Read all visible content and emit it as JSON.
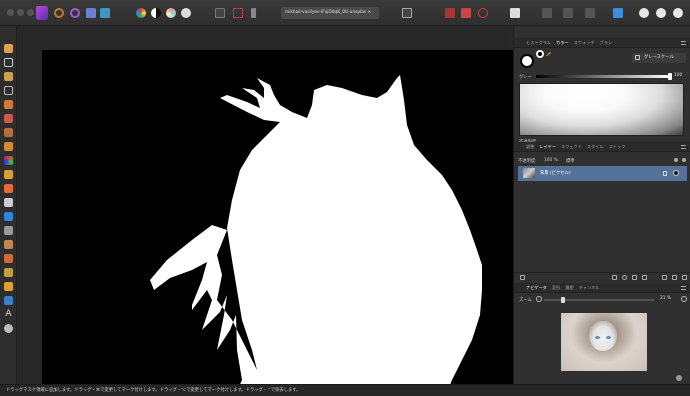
{
  "toolbar": {
    "file_tab_label": "mikhail-vasilyev-IFxjDdqK_0U-unsplas ×"
  },
  "color_panel": {
    "tabs": [
      "ヒストグラム",
      "カラー",
      "スウォッチ",
      "ブラシ"
    ],
    "active_tab": "カラー",
    "mode_button": "グレースケール",
    "gray_label": "グレー",
    "gray_value": "100",
    "opacity_label": "不透明度",
    "opacity_value": "100 %"
  },
  "layers_panel": {
    "tabs": [
      "調整",
      "レイヤー",
      "エフェクト",
      "スタイル",
      "ストック"
    ],
    "active_tab": "レイヤー",
    "opacity_label": "不透明度:",
    "opacity_value": "100 %",
    "blend_mode": "標準",
    "layer_name": "背景 (ピクセル)"
  },
  "navigator_panel": {
    "tabs": [
      "ナビゲータ",
      "変形",
      "履歴",
      "チャンネル"
    ],
    "active_tab": "ナビゲータ",
    "zoom_label": "ズーム",
    "zoom_value": "21 %"
  },
  "status_bar": {
    "text": "ドラッグマスク領域に追加します。ドラッグ・⌘で変更してマーク付けします。ドラッグ・⌥で変更してマーク付けします。ドラッグ・⌃で除去します。"
  }
}
